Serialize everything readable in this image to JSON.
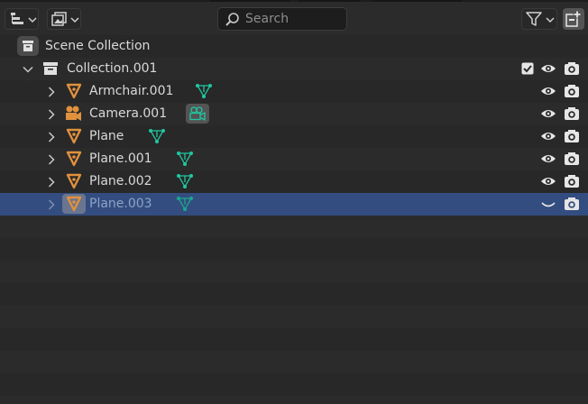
{
  "header": {
    "display_mode_icon": "outliner-tree-icon",
    "filter_mode_icon": "image-filter-icon",
    "search_placeholder": "Search",
    "filter_icon": "funnel-icon",
    "new_collection_icon": "new-collection-icon"
  },
  "tree": {
    "scene_collection": {
      "label": "Scene Collection",
      "icon": "scene-collection-icon"
    },
    "collection": {
      "label": "Collection.001",
      "icon": "collection-box-icon",
      "included": true,
      "visible": true,
      "renderable": true
    },
    "items": [
      {
        "label": "Armchair.001",
        "icon": "mesh-object-icon",
        "data_icon": "mesh-data-icon",
        "visible": true,
        "renderable": true
      },
      {
        "label": "Camera.001",
        "icon": "camera-object-icon",
        "data_icon": "camera-data-icon",
        "visible": true,
        "renderable": true
      },
      {
        "label": "Plane",
        "icon": "mesh-object-icon",
        "data_icon": "mesh-data-icon",
        "visible": true,
        "renderable": true
      },
      {
        "label": "Plane.001",
        "icon": "mesh-object-icon",
        "data_icon": "mesh-data-icon",
        "visible": true,
        "renderable": true
      },
      {
        "label": "Plane.002",
        "icon": "mesh-object-icon",
        "data_icon": "mesh-data-icon",
        "visible": true,
        "renderable": true
      },
      {
        "label": "Plane.003",
        "icon": "mesh-object-icon",
        "data_icon": "mesh-data-icon",
        "visible": false,
        "renderable": true,
        "selected": true
      }
    ]
  },
  "colors": {
    "background": "#282828",
    "row_alt": "#2b2b2b",
    "selected": "#334d80",
    "object_orange": "#e0913d",
    "data_green": "#1fc7a0",
    "text": "#d9d9d9"
  }
}
